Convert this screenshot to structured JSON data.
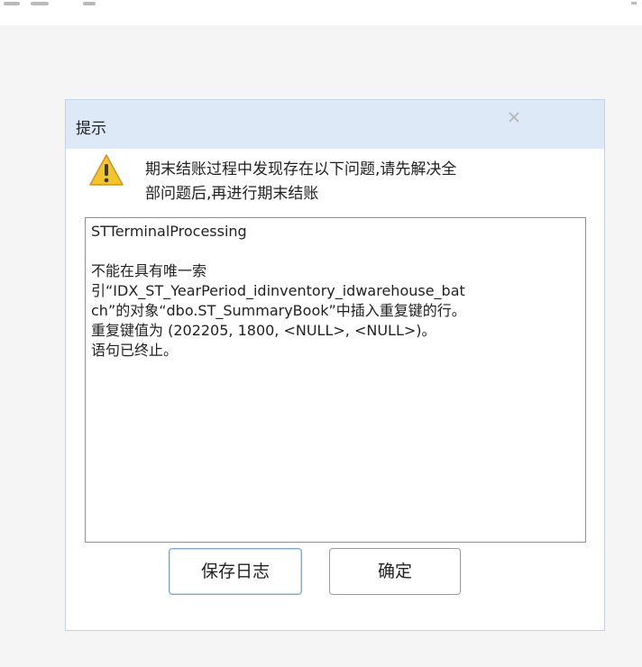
{
  "dialog": {
    "title": "提示",
    "message_lines": [
      "期末结账过程中发现存在以下问题,请先解决全",
      "部问题后,再进行期末结账"
    ],
    "details_lines": [
      "STTerminalProcessing",
      "",
      "不能在具有唯一索",
      "引“IDX_ST_YearPeriod_idinventory_idwarehouse_bat",
      "ch”的对象“dbo.ST_SummaryBook”中插入重复键的行。",
      "重复键值为 (202205, 1800, <NULL>, <NULL>)。",
      "语句已终止。"
    ],
    "buttons": {
      "save_log": "保存日志",
      "ok": "确定"
    },
    "icons": {
      "warning": "warning-icon",
      "close": "close-icon"
    }
  },
  "colors": {
    "header_bg": "#dde9f7",
    "dialog_border": "#bfd5ea",
    "warning_yellow": "#f3c52b"
  }
}
